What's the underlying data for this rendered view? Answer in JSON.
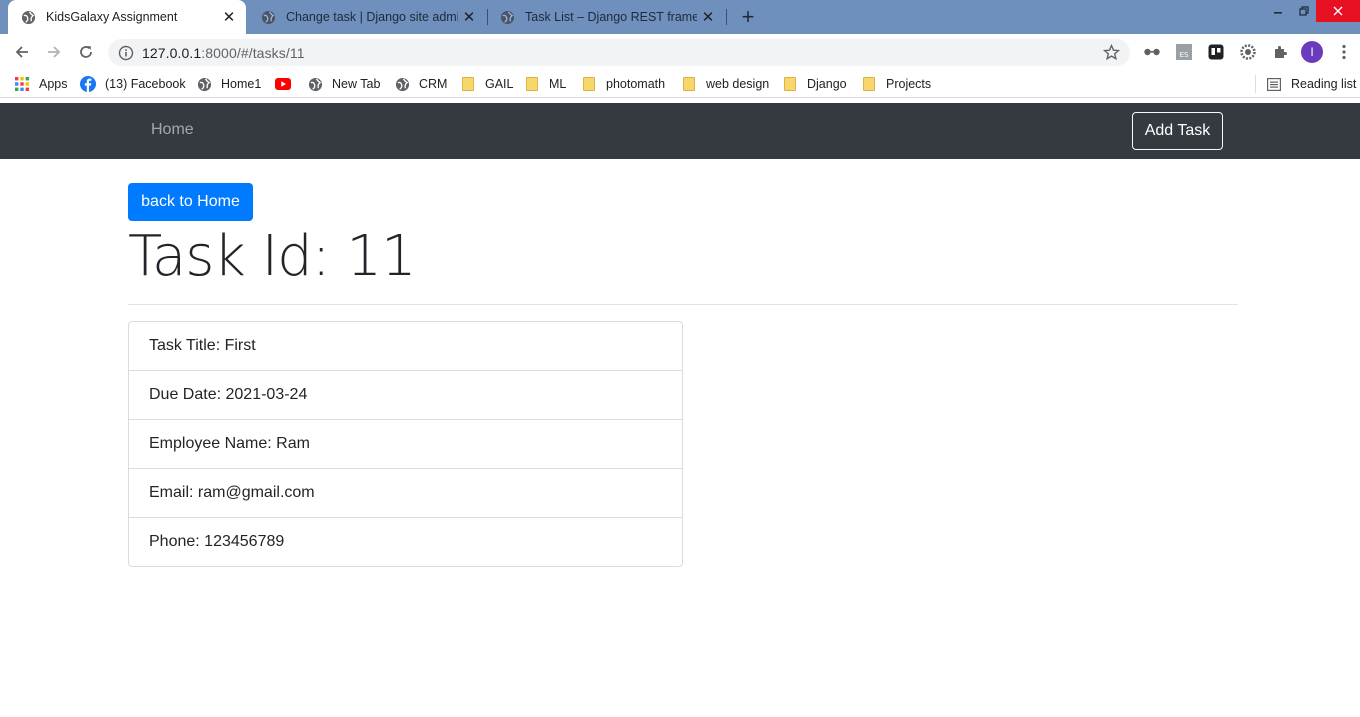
{
  "browser": {
    "tabs": [
      {
        "title": "KidsGalaxy Assignment",
        "active": true
      },
      {
        "title": "Change task | Django site admin",
        "active": false
      },
      {
        "title": "Task List – Django REST framewo",
        "active": false
      }
    ],
    "url_host": "127.0.0.1",
    "url_rest": ":8000/#/tasks/11",
    "profile_initial": "I",
    "ext_es_label": "ES"
  },
  "bookmarks": {
    "items": [
      {
        "label": "Apps",
        "icon": "apps-grid-icon"
      },
      {
        "label": "(13) Facebook",
        "icon": "facebook-icon"
      },
      {
        "label": "Home1",
        "icon": "globe-icon"
      },
      {
        "label": "",
        "icon": "youtube-icon"
      },
      {
        "label": "New Tab",
        "icon": "globe-icon"
      },
      {
        "label": "CRM",
        "icon": "globe-icon"
      },
      {
        "label": "GAIL",
        "icon": "folder-icon"
      },
      {
        "label": "ML",
        "icon": "folder-icon"
      },
      {
        "label": "photomath",
        "icon": "folder-icon"
      },
      {
        "label": "web design",
        "icon": "folder-icon"
      },
      {
        "label": "Django",
        "icon": "folder-icon"
      },
      {
        "label": "Projects",
        "icon": "folder-icon"
      }
    ],
    "reading_list": "Reading list"
  },
  "navbar": {
    "home_label": "Home",
    "add_task_label": "Add Task"
  },
  "page": {
    "back_button_label": "back to Home",
    "heading_label": "Task Id:",
    "task_id": "11",
    "details": [
      {
        "label": "Task Title:",
        "value": "First"
      },
      {
        "label": "Due Date:",
        "value": "2021-03-24"
      },
      {
        "label": "Employee Name:",
        "value": "Ram"
      },
      {
        "label": "Email:",
        "value": "ram@gmail.com"
      },
      {
        "label": "Phone:",
        "value": "123456789"
      }
    ]
  },
  "colors": {
    "tabstrip": "#6f8fbd",
    "navbar": "#343a40",
    "primary": "#007bff"
  }
}
